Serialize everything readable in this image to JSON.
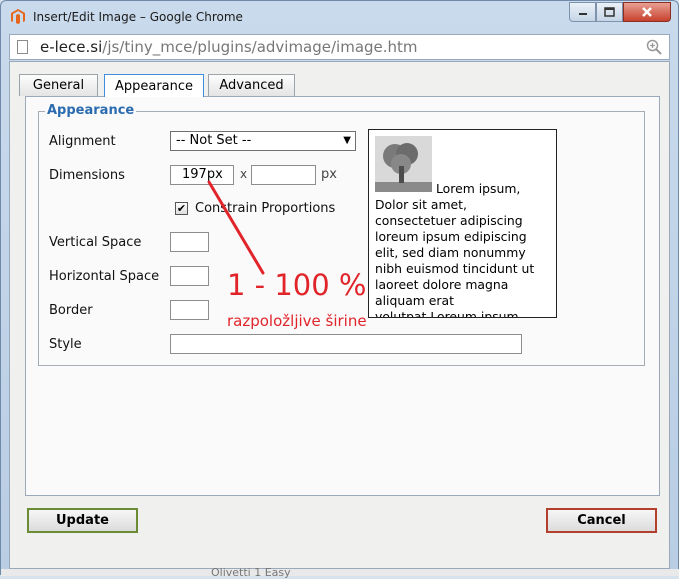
{
  "window": {
    "title": "Insert/Edit Image – Google Chrome",
    "app_icon": "magento-icon",
    "controls": [
      "minimize-icon",
      "maximize-icon",
      "close-icon"
    ]
  },
  "address": {
    "host": "e-lece.si",
    "path": "/js/tiny_mce/plugins/advimage/image.htm",
    "zoom_icon": "zoom-icon"
  },
  "tabs": [
    "General",
    "Appearance",
    "Advanced"
  ],
  "appearance": {
    "legend": "Appearance",
    "alignment_label": "Alignment",
    "alignment_value": "-- Not Set --",
    "dimensions_label": "Dimensions",
    "width_value": "197px",
    "x_sep": "x",
    "height_value": "",
    "unit": "px",
    "constrain_label": "Constrain Proportions",
    "constrain_checked": true,
    "vspace_label": "Vertical Space",
    "hspace_label": "Horizontal Space",
    "border_label": "Border",
    "style_label": "Style"
  },
  "preview": {
    "lines": [
      "Lorem ipsum,",
      "Dolor sit amet,",
      "consectetuer adipiscing",
      "loreum ipsum edipiscing",
      "elit, sed diam nonummy",
      "nibh euismod tincidunt ut",
      "laoreet dolore magna",
      "aliquam erat",
      "volutpat.Loreum ipsum"
    ]
  },
  "annotation": {
    "range": "1 - 100 %",
    "note": "razpoložljive širine",
    "color": "#e0242a"
  },
  "buttons": {
    "update": "Update",
    "cancel": "Cancel"
  },
  "background_text": "Olivetti 1 Easy"
}
